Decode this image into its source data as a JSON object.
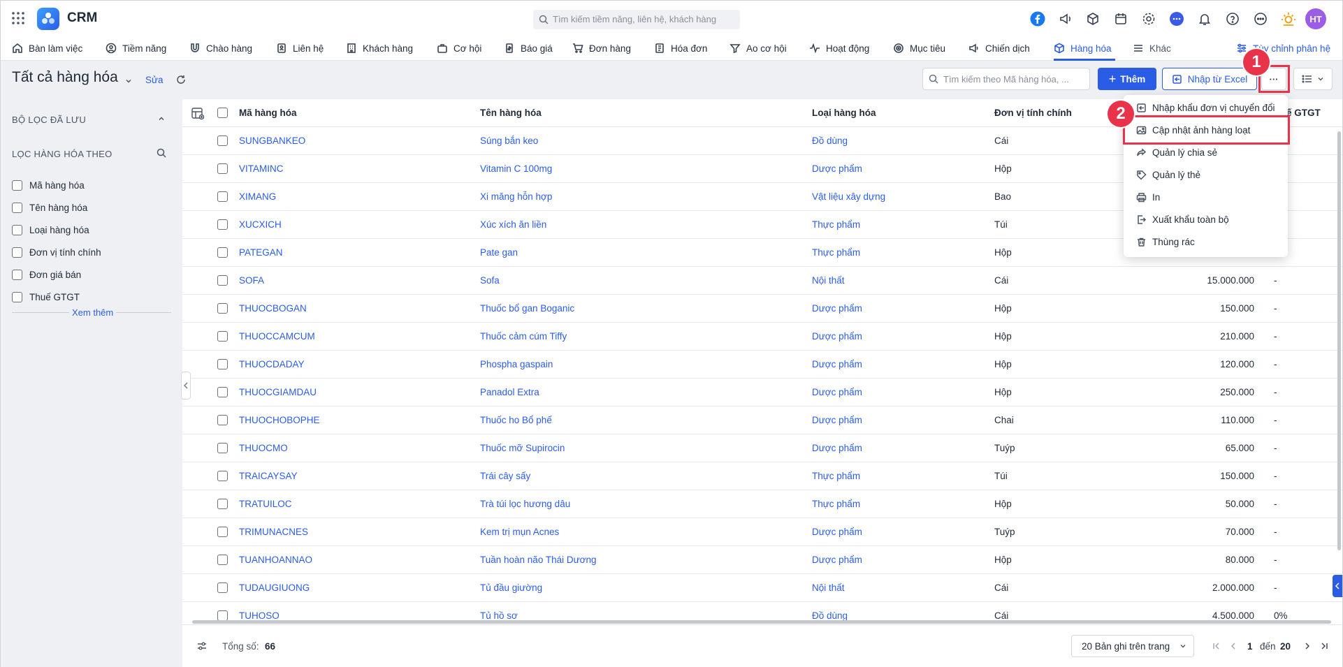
{
  "app": {
    "name": "CRM",
    "search_placeholder": "Tìm kiếm tiềm năng, liên hệ, khách hàng",
    "avatar": "HT"
  },
  "nav": [
    {
      "label": "Bàn làm việc",
      "icon": "home-icon"
    },
    {
      "label": "Tiềm năng",
      "icon": "person-icon"
    },
    {
      "label": "Chào hàng",
      "icon": "magnet-icon"
    },
    {
      "label": "Liên hệ",
      "icon": "contact-icon"
    },
    {
      "label": "Khách hàng",
      "icon": "building-icon"
    },
    {
      "label": "Cơ hội",
      "icon": "briefcase-icon"
    },
    {
      "label": "Báo giá",
      "icon": "quote-icon"
    },
    {
      "label": "Đơn hàng",
      "icon": "cart-icon"
    },
    {
      "label": "Hóa đơn",
      "icon": "invoice-icon"
    },
    {
      "label": "Ao cơ hội",
      "icon": "funnel-icon"
    },
    {
      "label": "Hoạt động",
      "icon": "activity-icon"
    },
    {
      "label": "Mục tiêu",
      "icon": "target-icon"
    },
    {
      "label": "Chiến dịch",
      "icon": "megaphone-icon"
    },
    {
      "label": "Hàng hóa",
      "icon": "box-icon",
      "active": true
    },
    {
      "label": "Khác",
      "icon": "menu-icon"
    }
  ],
  "nav_customize": "Tùy chỉnh phân hệ",
  "header": {
    "title": "Tất cả hàng hóa",
    "edit": "Sửa",
    "search_placeholder": "Tìm kiếm theo Mã hàng hóa, ...",
    "add": "Thêm",
    "import_excel": "Nhập từ Excel",
    "more": "···"
  },
  "sidebar": {
    "saved_filters": "BỘ LỌC ĐÃ LƯU",
    "filter_by": "LỌC HÀNG HÓA THEO",
    "filters": [
      "Mã hàng hóa",
      "Tên hàng hóa",
      "Loại hàng hóa",
      "Đơn vị tính chính",
      "Đơn giá bán",
      "Thuế GTGT"
    ],
    "see_more": "Xem thêm"
  },
  "table": {
    "columns": [
      "Mã hàng hóa",
      "Tên hàng hóa",
      "Loại hàng hóa",
      "Đơn vị tính chính",
      "ế GTGT"
    ],
    "rows": [
      {
        "code": "SUNGBANKEO",
        "name": "Súng bắn keo",
        "type": "Đồ dùng",
        "unit": "Cái",
        "price": "",
        "vat": ""
      },
      {
        "code": "VITAMINC",
        "name": "Vitamin C 100mg",
        "type": "Dược phẩm",
        "unit": "Hộp",
        "price": "",
        "vat": ""
      },
      {
        "code": "XIMANG",
        "name": "Xi măng hỗn hợp",
        "type": "Vật liệu xây dựng",
        "unit": "Bao",
        "price": "",
        "vat": ""
      },
      {
        "code": "XUCXICH",
        "name": "Xúc xích ăn liền",
        "type": "Thực phẩm",
        "unit": "Túi",
        "price": "",
        "vat": ""
      },
      {
        "code": "PATEGAN",
        "name": "Pate gan",
        "type": "Thực phẩm",
        "unit": "Hộp",
        "price": "",
        "vat": ""
      },
      {
        "code": "SOFA",
        "name": "Sofa",
        "type": "Nội thất",
        "unit": "Cái",
        "price": "15.000.000",
        "vat": "-"
      },
      {
        "code": "THUOCBOGAN",
        "name": "Thuốc bổ gan Boganic",
        "type": "Dược phẩm",
        "unit": "Hộp",
        "price": "150.000",
        "vat": "-"
      },
      {
        "code": "THUOCCAMCUM",
        "name": "Thuốc cảm cúm Tiffy",
        "type": "Dược phẩm",
        "unit": "Hộp",
        "price": "210.000",
        "vat": "-"
      },
      {
        "code": "THUOCDADAY",
        "name": "Phospha gaspain",
        "type": "Dược phẩm",
        "unit": "Hộp",
        "price": "120.000",
        "vat": "-"
      },
      {
        "code": "THUOCGIAMDAU",
        "name": "Panadol Extra",
        "type": "Dược phẩm",
        "unit": "Hộp",
        "price": "250.000",
        "vat": "-"
      },
      {
        "code": "THUOCHOBOPHE",
        "name": "Thuốc ho Bổ phế",
        "type": "Dược phẩm",
        "unit": "Chai",
        "price": "110.000",
        "vat": "-"
      },
      {
        "code": "THUOCMO",
        "name": "Thuốc mỡ Supirocin",
        "type": "Dược phẩm",
        "unit": "Tuýp",
        "price": "65.000",
        "vat": "-"
      },
      {
        "code": "TRAICAYSAY",
        "name": "Trái cây sấy",
        "type": "Thực phẩm",
        "unit": "Túi",
        "price": "150.000",
        "vat": "-"
      },
      {
        "code": "TRATUILOC",
        "name": "Trà túi lọc hương dâu",
        "type": "Thực phẩm",
        "unit": "Hộp",
        "price": "50.000",
        "vat": "-"
      },
      {
        "code": "TRIMUNACNES",
        "name": "Kem trị mụn Acnes",
        "type": "Dược phẩm",
        "unit": "Tuýp",
        "price": "70.000",
        "vat": "-"
      },
      {
        "code": "TUANHOANNAO",
        "name": "Tuần hoàn não Thái Dương",
        "type": "Dược phẩm",
        "unit": "Hộp",
        "price": "80.000",
        "vat": "-"
      },
      {
        "code": "TUDAUGIUONG",
        "name": "Tủ đầu giường",
        "type": "Nội thất",
        "unit": "Cái",
        "price": "2.000.000",
        "vat": "-"
      },
      {
        "code": "TUHOSO",
        "name": "Tủ hồ sơ",
        "type": "Đồ dùng",
        "unit": "Cái",
        "price": "4.500.000",
        "vat": "0%"
      }
    ]
  },
  "dropdown": [
    {
      "label": "Nhập khẩu đơn vị chuyển đổi",
      "icon": "import-icon"
    },
    {
      "label": "Cập nhật ảnh hàng loạt",
      "icon": "image-icon"
    },
    {
      "label": "Quản lý chia sẻ",
      "icon": "share-icon"
    },
    {
      "label": "Quản lý thẻ",
      "icon": "tag-icon"
    },
    {
      "label": "In",
      "icon": "print-icon"
    },
    {
      "label": "Xuất khẩu toàn bộ",
      "icon": "export-icon"
    },
    {
      "label": "Thùng rác",
      "icon": "trash-icon"
    }
  ],
  "callouts": [
    "1",
    "2"
  ],
  "footer": {
    "total_label": "Tổng số:",
    "total": "66",
    "page_size": "20 Bản ghi trên trang",
    "page_from": "1",
    "to_label": "đến",
    "page_to": "20"
  },
  "colors": {
    "accent": "#2b5ce6",
    "highlight": "#e8334a",
    "bg": "#eef0f4"
  }
}
